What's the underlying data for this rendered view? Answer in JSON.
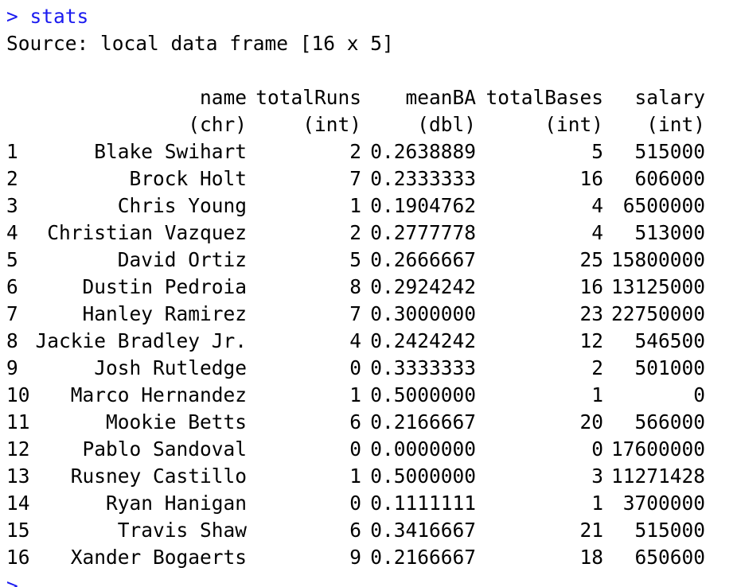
{
  "prompt": ">",
  "command": "stats",
  "source_line": "Source: local data frame [16 x 5]",
  "columns": [
    {
      "name": "name",
      "type": "(chr)"
    },
    {
      "name": "totalRuns",
      "type": "(int)"
    },
    {
      "name": "meanBA",
      "type": "(dbl)"
    },
    {
      "name": "totalBases",
      "type": "(int)"
    },
    {
      "name": "salary",
      "type": "(int)"
    }
  ],
  "rows": [
    {
      "idx": "1",
      "name": "Blake Swihart",
      "totalRuns": "2",
      "meanBA": "0.2638889",
      "totalBases": "5",
      "salary": "515000"
    },
    {
      "idx": "2",
      "name": "Brock Holt",
      "totalRuns": "7",
      "meanBA": "0.2333333",
      "totalBases": "16",
      "salary": "606000"
    },
    {
      "idx": "3",
      "name": "Chris Young",
      "totalRuns": "1",
      "meanBA": "0.1904762",
      "totalBases": "4",
      "salary": "6500000"
    },
    {
      "idx": "4",
      "name": "Christian Vazquez",
      "totalRuns": "2",
      "meanBA": "0.2777778",
      "totalBases": "4",
      "salary": "513000"
    },
    {
      "idx": "5",
      "name": "David Ortiz",
      "totalRuns": "5",
      "meanBA": "0.2666667",
      "totalBases": "25",
      "salary": "15800000"
    },
    {
      "idx": "6",
      "name": "Dustin Pedroia",
      "totalRuns": "8",
      "meanBA": "0.2924242",
      "totalBases": "16",
      "salary": "13125000"
    },
    {
      "idx": "7",
      "name": "Hanley Ramirez",
      "totalRuns": "7",
      "meanBA": "0.3000000",
      "totalBases": "23",
      "salary": "22750000"
    },
    {
      "idx": "8",
      "name": "Jackie Bradley Jr.",
      "totalRuns": "4",
      "meanBA": "0.2424242",
      "totalBases": "12",
      "salary": "546500"
    },
    {
      "idx": "9",
      "name": "Josh Rutledge",
      "totalRuns": "0",
      "meanBA": "0.3333333",
      "totalBases": "2",
      "salary": "501000"
    },
    {
      "idx": "10",
      "name": "Marco Hernandez",
      "totalRuns": "1",
      "meanBA": "0.5000000",
      "totalBases": "1",
      "salary": "0"
    },
    {
      "idx": "11",
      "name": "Mookie Betts",
      "totalRuns": "6",
      "meanBA": "0.2166667",
      "totalBases": "20",
      "salary": "566000"
    },
    {
      "idx": "12",
      "name": "Pablo Sandoval",
      "totalRuns": "0",
      "meanBA": "0.0000000",
      "totalBases": "0",
      "salary": "17600000"
    },
    {
      "idx": "13",
      "name": "Rusney Castillo",
      "totalRuns": "1",
      "meanBA": "0.5000000",
      "totalBases": "3",
      "salary": "11271428"
    },
    {
      "idx": "14",
      "name": "Ryan Hanigan",
      "totalRuns": "0",
      "meanBA": "0.1111111",
      "totalBases": "1",
      "salary": "3700000"
    },
    {
      "idx": "15",
      "name": "Travis Shaw",
      "totalRuns": "6",
      "meanBA": "0.3416667",
      "totalBases": "21",
      "salary": "515000"
    },
    {
      "idx": "16",
      "name": "Xander Bogaerts",
      "totalRuns": "9",
      "meanBA": "0.2166667",
      "totalBases": "18",
      "salary": "650600"
    }
  ],
  "colors": {
    "command": "#1a1af0",
    "text": "#000000",
    "background": "#ffffff"
  }
}
